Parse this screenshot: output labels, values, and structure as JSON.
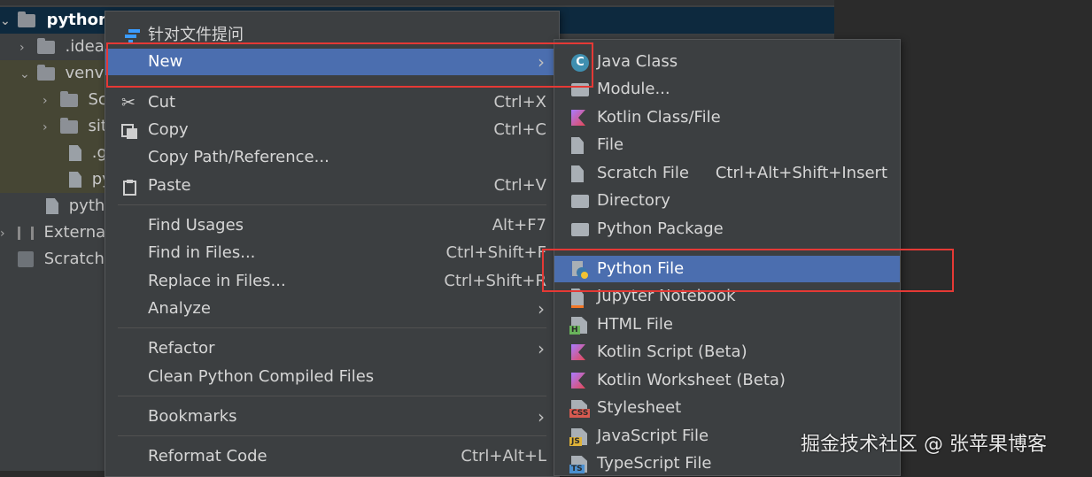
{
  "project": {
    "root": "python-",
    "items": [
      ".idea",
      "venv",
      "Sc",
      "sit",
      ".g",
      "py",
      "pytho",
      "External",
      "Scratche"
    ]
  },
  "context_menu": {
    "header": "针对文件提问",
    "new": "New",
    "cut": {
      "label": "Cut",
      "shortcut": "Ctrl+X"
    },
    "copy": {
      "label": "Copy",
      "shortcut": "Ctrl+C"
    },
    "copy_path": "Copy Path/Reference...",
    "paste": {
      "label": "Paste",
      "shortcut": "Ctrl+V"
    },
    "find_usages": {
      "label": "Find Usages",
      "shortcut": "Alt+F7"
    },
    "find_in_files": {
      "label": "Find in Files...",
      "shortcut": "Ctrl+Shift+F"
    },
    "replace_in_files": {
      "label": "Replace in Files...",
      "shortcut": "Ctrl+Shift+R"
    },
    "analyze": "Analyze",
    "refactor": "Refactor",
    "clean_python": "Clean Python Compiled Files",
    "bookmarks": "Bookmarks",
    "reformat": {
      "label": "Reformat Code",
      "shortcut": "Ctrl+Alt+L"
    }
  },
  "new_submenu": {
    "java_class": "Java Class",
    "module": "Module...",
    "kotlin_class": "Kotlin Class/File",
    "file": "File",
    "scratch_file": {
      "label": "Scratch File",
      "shortcut": "Ctrl+Alt+Shift+Insert"
    },
    "directory": "Directory",
    "python_package": "Python Package",
    "python_file": "Python File",
    "jupyter": "Jupyter Notebook",
    "html_file": "HTML File",
    "kotlin_script": "Kotlin Script (Beta)",
    "kotlin_worksheet": "Kotlin Worksheet (Beta)",
    "stylesheet": "Stylesheet",
    "javascript_file": "JavaScript File",
    "typescript_file": "TypeScript File",
    "icon_tags": {
      "html": "H",
      "css": "CSS",
      "js": "JS",
      "ts": "TS"
    }
  },
  "watermark": "掘金技术社区 @ 张苹果博客",
  "colors": {
    "highlight": "#4b6eaf",
    "annotation": "#e53935",
    "menu_bg": "#3c3f41"
  }
}
